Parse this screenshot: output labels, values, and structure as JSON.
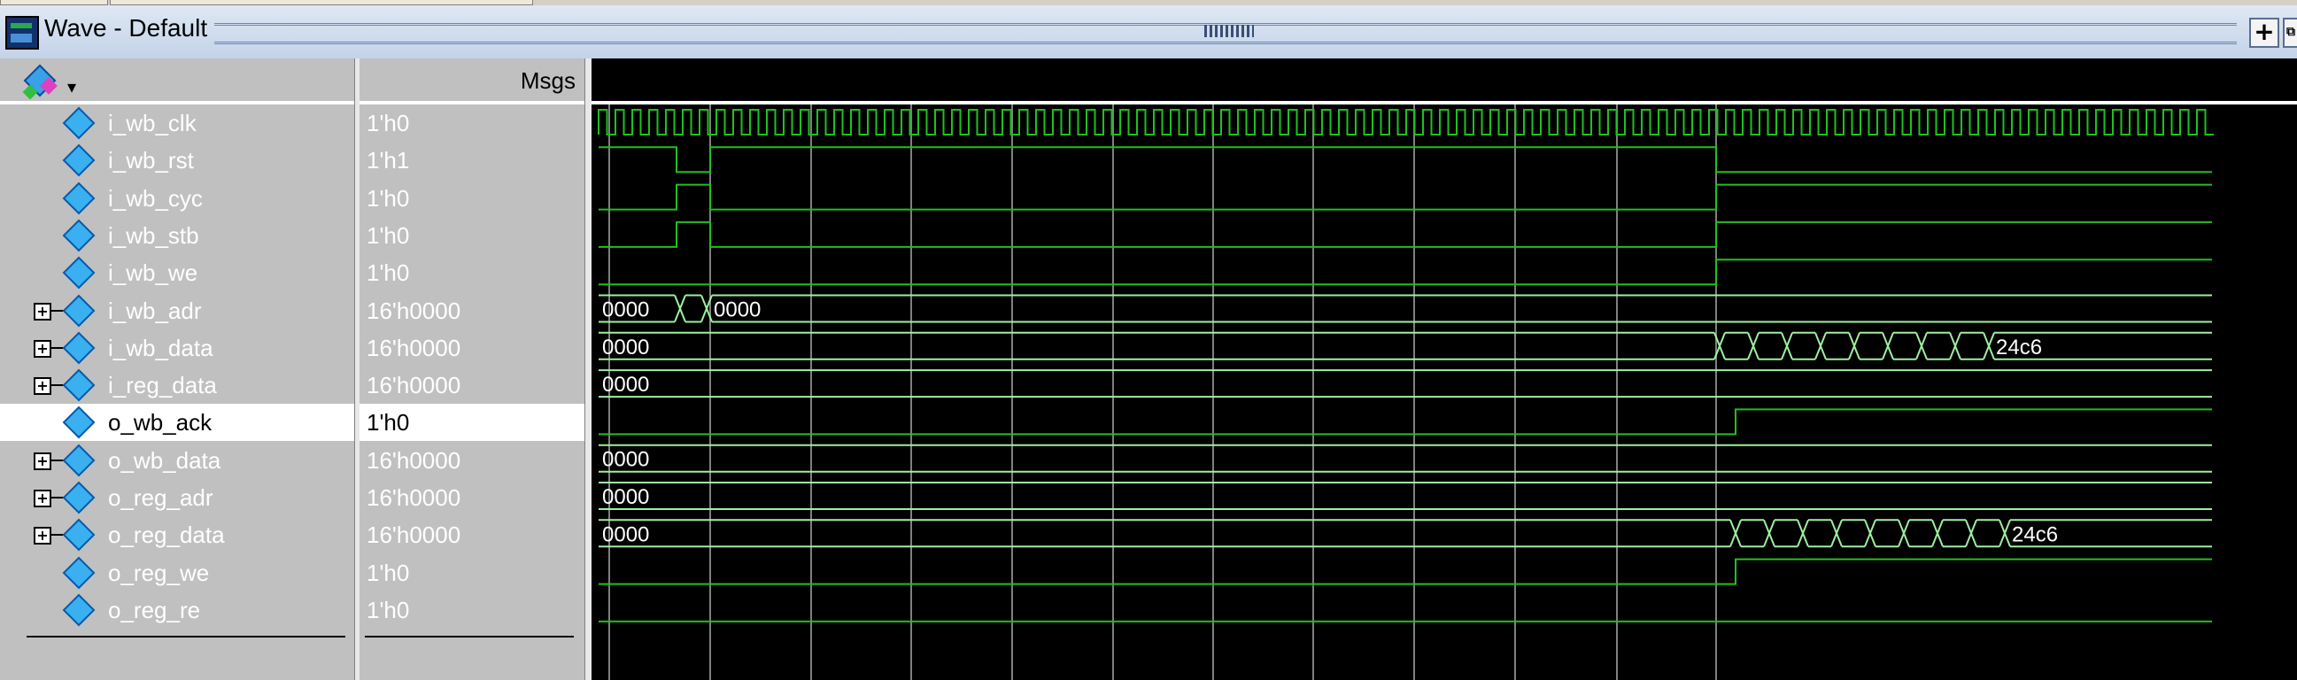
{
  "window": {
    "title": "Wave - Default",
    "maximize_label": "+",
    "dock_label": "⧉"
  },
  "names_pane": {
    "toolbar_icon": "wave-tool-icon",
    "toolbar_dropdown": "▾"
  },
  "values_pane": {
    "header": "Msgs"
  },
  "signals": [
    {
      "name": "i_wb_clk",
      "value": "1'h0",
      "expandable": false,
      "kind": "clock"
    },
    {
      "name": "i_wb_rst",
      "value": "1'h1",
      "expandable": false,
      "kind": "bit"
    },
    {
      "name": "i_wb_cyc",
      "value": "1'h0",
      "expandable": false,
      "kind": "bit"
    },
    {
      "name": "i_wb_stb",
      "value": "1'h0",
      "expandable": false,
      "kind": "bit"
    },
    {
      "name": "i_wb_we",
      "value": "1'h0",
      "expandable": false,
      "kind": "bit"
    },
    {
      "name": "i_wb_adr",
      "value": "16'h0000",
      "expandable": true,
      "kind": "bus"
    },
    {
      "name": "i_wb_data",
      "value": "16'h0000",
      "expandable": true,
      "kind": "bus"
    },
    {
      "name": "i_reg_data",
      "value": "16'h0000",
      "expandable": true,
      "kind": "bus"
    },
    {
      "name": "o_wb_ack",
      "value": "1'h0",
      "expandable": false,
      "kind": "bit",
      "selected": true
    },
    {
      "name": "o_wb_data",
      "value": "16'h0000",
      "expandable": true,
      "kind": "bus"
    },
    {
      "name": "o_reg_adr",
      "value": "16'h0000",
      "expandable": true,
      "kind": "bus"
    },
    {
      "name": "o_reg_data",
      "value": "16'h0000",
      "expandable": true,
      "kind": "bus"
    },
    {
      "name": "o_reg_we",
      "value": "1'h0",
      "expandable": false,
      "kind": "bit"
    },
    {
      "name": "o_reg_re",
      "value": "1'h0",
      "expandable": false,
      "kind": "bit"
    }
  ],
  "wave_labels": {
    "i_wb_adr_a": "0000",
    "i_wb_adr_b": "0000",
    "i_wb_data_a": "0000",
    "i_wb_data_end": "24c6",
    "i_reg_data_a": "0000",
    "o_wb_data_a": "0000",
    "o_reg_adr_a": "0000",
    "o_reg_data_a": "0000",
    "o_reg_data_end": "24c6"
  },
  "colors": {
    "wave_bit": "#20c020",
    "wave_bus": "#9ef0a0",
    "grid": "#808080",
    "background": "#000000",
    "text_on_wave": "#ffffff"
  }
}
